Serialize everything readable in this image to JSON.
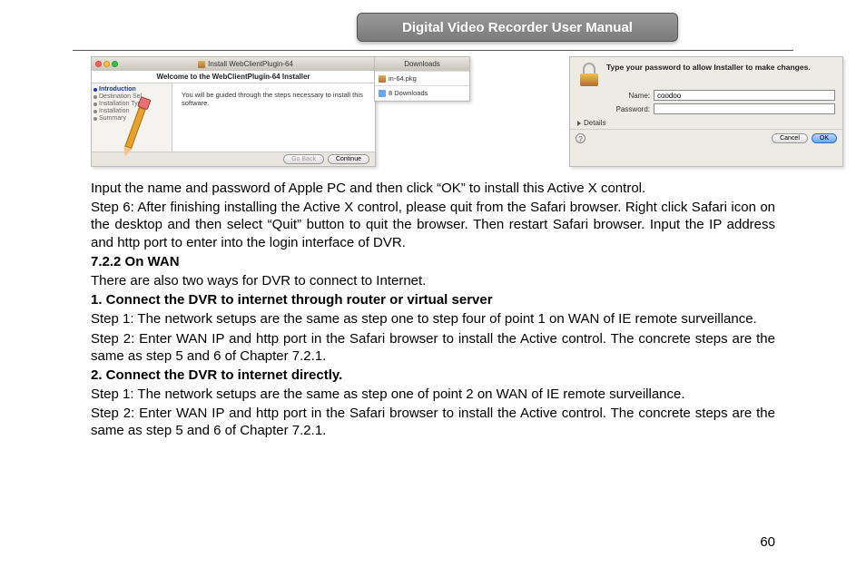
{
  "header": {
    "title": "Digital Video Recorder User Manual"
  },
  "installer": {
    "window_title": "Install WebClientPlugin-64",
    "welcome": "Welcome to the WebClientPlugin-64 Installer",
    "steps": [
      "Introduction",
      "Destination Sel",
      "Installation Type",
      "Installation",
      "Summary"
    ],
    "body": "You will be guided through the steps necessary to install this software.",
    "go_back": "Go Back",
    "continue": "Continue"
  },
  "downloads": {
    "title": "Downloads",
    "items": [
      "in-64.pkg",
      "8 Downloads"
    ]
  },
  "auth": {
    "message": "Type your password to allow Installer to make changes.",
    "name_label": "Name:",
    "name_value": "coodoo",
    "password_label": "Password:",
    "password_value": "",
    "details": "Details",
    "cancel": "Cancel",
    "ok": "OK"
  },
  "body": {
    "p1": "Input the name and password of Apple PC and then click “OK” to install this Active X control.",
    "p2": "Step 6: After finishing installing the Active X control, please quit from the Safari browser. Right click Safari icon on the desktop and then select “Quit” button to quit the browser. Then restart Safari browser. Input the IP address and http port to enter into the login interface of DVR.",
    "sect": "7.2.2  On WAN",
    "intro": "There are also two ways for DVR to connect to Internet.",
    "h1": "1. Connect the DVR to internet through router or virtual server",
    "h1s1": "Step 1: The network setups are the same as step one to step four of point 1 on WAN of IE remote surveillance.",
    "h1s2": "Step 2: Enter WAN IP and http port in the Safari browser to install the Active control. The concrete steps are the same as step 5 and 6 of Chapter 7.2.1.",
    "h2": "2. Connect the DVR to internet directly.",
    "h2s1": "Step 1: The network setups are the same as step one of point 2 on WAN of IE remote surveillance.",
    "h2s2": "Step 2: Enter WAN IP and http port in the Safari browser to install the Active control. The concrete steps are the same as step 5 and 6 of Chapter 7.2.1."
  },
  "page": "60"
}
